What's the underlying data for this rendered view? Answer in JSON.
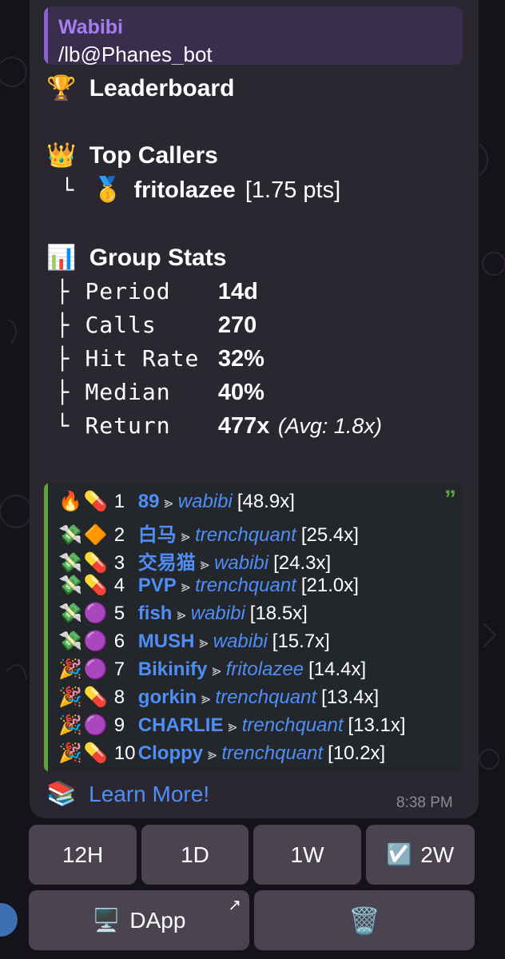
{
  "reply": {
    "name": "Wabibi",
    "text": "/lb@Phanes_bot"
  },
  "leaderboard": {
    "emoji": "🏆",
    "title": "Leaderboard"
  },
  "top_callers": {
    "emoji": "👑",
    "title": "Top Callers",
    "entries": [
      {
        "tree": "└",
        "medal": "🥇",
        "name": "fritolazee",
        "pts": "[1.75 pts]"
      }
    ]
  },
  "group_stats": {
    "emoji": "📊",
    "title": "Group Stats",
    "rows": [
      {
        "tree": "├",
        "label": "Period",
        "value": "14d",
        "extra": ""
      },
      {
        "tree": "├",
        "label": "Calls",
        "value": "270",
        "extra": ""
      },
      {
        "tree": "├",
        "label": "Hit Rate",
        "value": "32%",
        "extra": ""
      },
      {
        "tree": "├",
        "label": "Median",
        "value": "40%",
        "extra": ""
      },
      {
        "tree": "└",
        "label": "Return",
        "value": "477x",
        "extra": "(Avg: 1.8x)"
      }
    ]
  },
  "calls": [
    {
      "emoji1": "🔥",
      "emoji2": "💊",
      "rank": "1",
      "coin": "89",
      "caller": "wabibi",
      "mult": "[48.9x]"
    },
    {
      "emoji1": "💸",
      "emoji2": "🔶",
      "rank": "2",
      "coin": "白马",
      "caller": "trenchquant",
      "mult": "[25.4x]"
    },
    {
      "emoji1": "💸",
      "emoji2": "💊",
      "rank": "3",
      "coin": "交易猫",
      "caller": "wabibi",
      "mult": "[24.3x]"
    },
    {
      "emoji1": "💸",
      "emoji2": "💊",
      "rank": "4",
      "coin": "PVP",
      "caller": "trenchquant",
      "mult": "[21.0x]"
    },
    {
      "emoji1": "💸",
      "emoji2": "🟣",
      "rank": "5",
      "coin": "fish",
      "caller": "wabibi",
      "mult": "[18.5x]"
    },
    {
      "emoji1": "💸",
      "emoji2": "🟣",
      "rank": "6",
      "coin": "MUSH",
      "caller": "wabibi",
      "mult": "[15.7x]"
    },
    {
      "emoji1": "🎉",
      "emoji2": "🟣",
      "rank": "7",
      "coin": "Bikinify",
      "caller": "fritolazee",
      "mult": "[14.4x]"
    },
    {
      "emoji1": "🎉",
      "emoji2": "💊",
      "rank": "8",
      "coin": "gorkin",
      "caller": "trenchquant",
      "mult": "[13.4x]"
    },
    {
      "emoji1": "🎉",
      "emoji2": "🟣",
      "rank": "9",
      "coin": "CHARLIE",
      "caller": "trenchquant",
      "mult": "[13.1x]"
    },
    {
      "emoji1": "🎉",
      "emoji2": "💊",
      "rank": "10",
      "coin": "Cloppy",
      "caller": "trenchquant",
      "mult": "[10.2x]"
    }
  ],
  "arrow_glyph": "⪢",
  "quote_mark": "”",
  "learn_more": {
    "emoji": "📚",
    "label": "Learn More!"
  },
  "timestamp": "8:38 PM",
  "buttons": {
    "period": [
      {
        "label": "12H",
        "checked": false
      },
      {
        "label": "1D",
        "checked": false
      },
      {
        "label": "1W",
        "checked": false
      },
      {
        "label": "2W",
        "checked": true,
        "check_emoji": "☑️"
      }
    ],
    "dapp": {
      "emoji": "🖥️",
      "label": "DApp",
      "ext_icon": "↗"
    },
    "trash": {
      "emoji": "🗑️"
    }
  },
  "colors": {
    "link": "#4f8ef7",
    "reply_accent": "#a47ef0",
    "quote_accent": "#5aa63a",
    "bubble": "#2b2730",
    "button": "#4a4450"
  }
}
